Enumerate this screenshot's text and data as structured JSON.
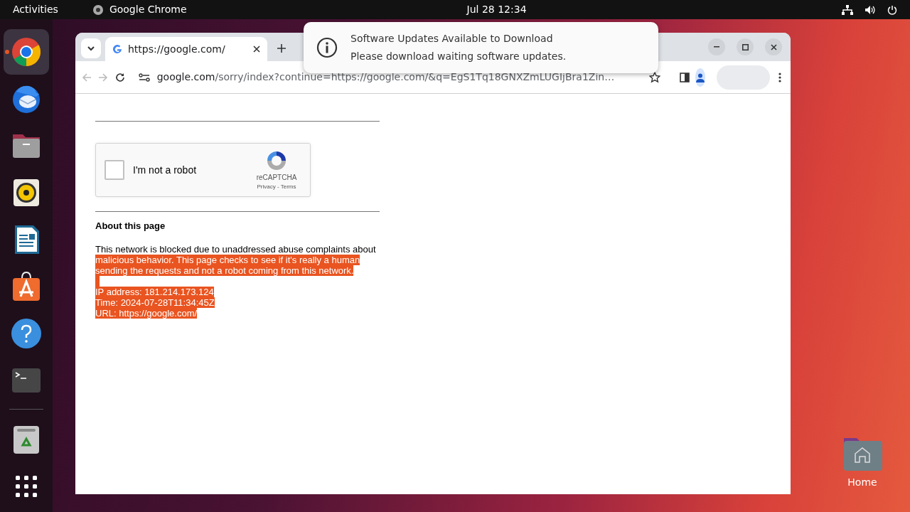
{
  "top_bar": {
    "activities": "Activities",
    "app_name": "Google Chrome",
    "clock": "Jul 28  12:34"
  },
  "dock": [
    {
      "kind": "browser",
      "running": true
    },
    {
      "kind": "mail",
      "running": false
    },
    {
      "kind": "files",
      "running": false
    },
    {
      "kind": "music",
      "running": false
    },
    {
      "kind": "writer",
      "running": false
    },
    {
      "kind": "store",
      "running": false
    },
    {
      "kind": "help",
      "running": false
    },
    {
      "kind": "terminal",
      "running": false
    },
    {
      "kind": "trash",
      "running": false
    },
    {
      "kind": "apps",
      "running": false
    }
  ],
  "browser": {
    "tabs": [
      {
        "title": "https://google.com/",
        "selected": true
      }
    ],
    "address": {
      "host": "google.com",
      "rest": "/sorry/index?continue=https://google.com/&q=EgS1Tq18GNXZmLUGIjBra1Zin…"
    },
    "page": {
      "captcha": {
        "label": "I'm not a robot",
        "checked": false,
        "brand": "reCAPTCHA",
        "links": "Privacy - Terms"
      },
      "heading": "About this page",
      "paragraph": [
        {
          "text": "This network is blocked due to unaddressed abuse complaints about ",
          "selected": false
        },
        {
          "text": "malicious behavior. This page checks to see if it's really a human sending the requests and not a robot coming from this network. ",
          "selected": true
        }
      ],
      "details": [
        {
          "text": "IP address: 181.214.173.124",
          "selected": true
        },
        {
          "text": "Time: 2024-07-28T11:34:45Z",
          "selected": true
        },
        {
          "text": "URL: https://google.com/",
          "selected": true
        }
      ]
    }
  },
  "notification": {
    "title": "Software Updates Available to Download",
    "body": "Please download waiting software updates."
  },
  "desktop": {
    "icons": [
      {
        "label": "Home"
      }
    ]
  }
}
